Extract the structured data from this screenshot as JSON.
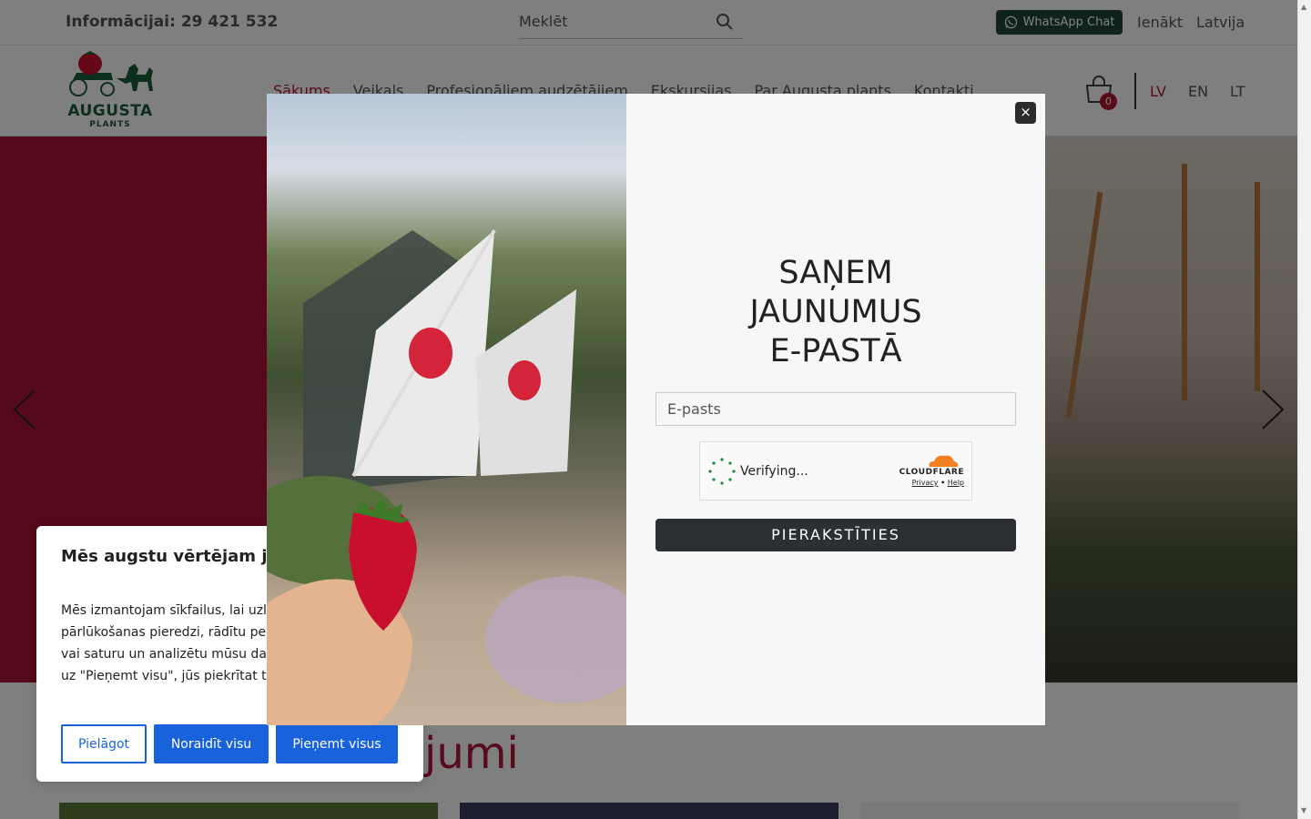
{
  "topbar": {
    "info": "Informācijai: 29 421 532",
    "search_placeholder": "Meklēt",
    "whatsapp_label": "WhatsApp Chat",
    "login": "Ienākt",
    "country": "Latvija"
  },
  "header": {
    "logo_text": "AUGUSTA",
    "logo_sub": "PLANTS",
    "nav": [
      {
        "label": "Sākums",
        "active": true
      },
      {
        "label": "Veikals"
      },
      {
        "label": "Profesionāliem audzētājiem"
      },
      {
        "label": "Ekskursijas"
      },
      {
        "label": "Par Augusta plants"
      },
      {
        "label": "Kontakti"
      }
    ],
    "cart_count": "0",
    "languages": [
      "LV",
      "EN",
      "LT"
    ],
    "active_language": "LV"
  },
  "section": {
    "title_fragment": "jumi"
  },
  "modal": {
    "close": "×",
    "title_lines": [
      "SAŅEM",
      "JAUNUMUS",
      "E-PASTĀ"
    ],
    "email_placeholder": "E-pasts",
    "captcha_status": "Verifying...",
    "captcha_brand": "CLOUDFLARE",
    "captcha_privacy": "Privacy",
    "captcha_sep": "•",
    "captcha_help": "Help",
    "subscribe": "PIERAKSTĪTIES"
  },
  "cookie": {
    "title": "Mēs augstu vērtējam jūsu privātumu",
    "text": "Mēs izmantojam sīkfailus, lai uzlabotu jūsu pārlūkošanas pieredzi, rādītu personalizētas reklāmas vai saturu un analizētu mūsu datplūsmu. Noklikšķinot uz \"Pieņemt visu\", jūs piekrītat to izmantošanai.",
    "customise": "Pielāgot",
    "reject": "Noraidīt visu",
    "accept": "Pieņemt visus"
  },
  "colors": {
    "brand_red": "#b0163a",
    "brand_green": "#1f4737",
    "cookie_blue": "#1863dc",
    "dark_button": "#2c3034"
  }
}
